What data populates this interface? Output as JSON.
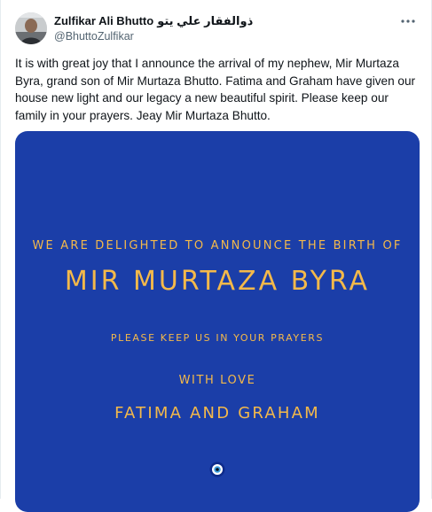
{
  "tweet": {
    "author_name": "Zulfikar Ali Bhutto",
    "author_name_urdu": "ذوالفقار علي يتو",
    "handle": "@BhuttoZulfikar",
    "more_icon": "more-horizontal-icon",
    "text": "It is with great joy that I announce the arrival of my nephew, Mir Murtaza Byra, grand son of Mir Murtaza Bhutto. Fatima and Graham have given our house new light and our legacy a new beautiful spirit. Please keep our family in your prayers. Jeay Mir Murtaza Bhutto."
  },
  "media": {
    "line1": "WE ARE DELIGHTED TO ANNOUNCE THE BIRTH OF",
    "line2": "MIR MURTAZA BYRA",
    "line3": "PLEASE KEEP US IN YOUR PRAYERS",
    "line4": "WITH LOVE",
    "line5": "FATIMA AND GRAHAM",
    "background_color": "#1b3ea8",
    "text_color": "#f4b94a",
    "icon": "evil-eye-icon"
  }
}
